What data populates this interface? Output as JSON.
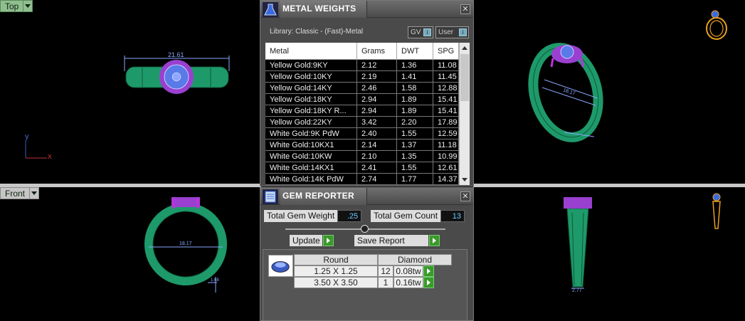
{
  "viewports": {
    "top": {
      "label": "Top",
      "dimension": "21.61",
      "axis_y": "y",
      "axis_x": "x"
    },
    "front": {
      "label": "Front",
      "dimension": "18.17",
      "dimension_small": "1.68"
    },
    "perspective": {
      "dimension": "18.17"
    },
    "right": {
      "dimension": "2.77"
    }
  },
  "metal_weights": {
    "title": "METAL WEIGHTS",
    "library": "Library: Classic - (Fast)-Metal",
    "gv_label": "GV",
    "user_label": "User",
    "columns": [
      "Metal",
      "Grams",
      "DWT",
      "SPG"
    ],
    "rows": [
      [
        "Yellow Gold:9KY",
        "2.12",
        "1.36",
        "11.08"
      ],
      [
        "Yellow Gold:10KY",
        "2.19",
        "1.41",
        "11.45"
      ],
      [
        "Yellow Gold:14KY",
        "2.46",
        "1.58",
        "12.88"
      ],
      [
        "Yellow Gold:18KY",
        "2.94",
        "1.89",
        "15.41"
      ],
      [
        "Yellow Gold:18KY R...",
        "2.94",
        "1.89",
        "15.41"
      ],
      [
        "Yellow Gold:22KY",
        "3.42",
        "2.20",
        "17.89"
      ],
      [
        "White Gold:9K PdW",
        "2.40",
        "1.55",
        "12.59"
      ],
      [
        "White Gold:10KX1",
        "2.14",
        "1.37",
        "11.18"
      ],
      [
        "White Gold:10KW",
        "2.10",
        "1.35",
        "10.99"
      ],
      [
        "White Gold:14KX1",
        "2.41",
        "1.55",
        "12.61"
      ],
      [
        "White Gold:14K PdW",
        "2.74",
        "1.77",
        "14.37"
      ]
    ]
  },
  "gem_reporter": {
    "title": "GEM REPORTER",
    "total_weight_label": "Total Gem Weight",
    "total_weight_value": ".25",
    "total_count_label": "Total Gem Count",
    "total_count_value": "13",
    "update_label": "Update",
    "save_label": "Save Report",
    "shape": "Round",
    "material": "Diamond",
    "rows": [
      {
        "size": "1.25 X 1.25",
        "count": "12",
        "weight": "0.08tw"
      },
      {
        "size": "3.50 X 3.50",
        "count": "1",
        "weight": "0.16tw"
      }
    ]
  },
  "colors": {
    "ring": "#22a06a",
    "gem_blue": "#4a6ee0",
    "prong": "#a020c0",
    "accent_green": "#3a9a2a"
  }
}
